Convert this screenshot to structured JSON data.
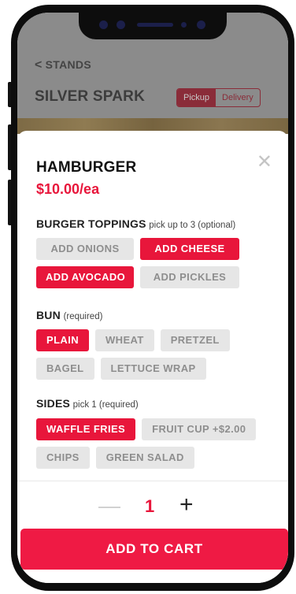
{
  "header": {
    "back_label": "STANDS",
    "store_name": "SILVER SPARK",
    "modes": [
      "Pickup",
      "Delivery"
    ]
  },
  "item": {
    "name": "HAMBURGER",
    "price": "$10.00/ea",
    "close_symbol": "✕"
  },
  "toppings": {
    "label": "BURGER TOPPINGS",
    "hint": "pick up to 3 (optional)",
    "options": [
      {
        "label": "ADD ONIONS",
        "selected": false
      },
      {
        "label": "ADD CHEESE",
        "selected": true
      },
      {
        "label": "ADD AVOCADO",
        "selected": true
      },
      {
        "label": "ADD PICKLES",
        "selected": false
      }
    ]
  },
  "bun": {
    "label": "BUN",
    "hint": "(required)",
    "options": [
      {
        "label": "PLAIN",
        "selected": true
      },
      {
        "label": "WHEAT",
        "selected": false
      },
      {
        "label": "PRETZEL",
        "selected": false
      },
      {
        "label": "BAGEL",
        "selected": false
      },
      {
        "label": "LETTUCE WRAP",
        "selected": false
      }
    ]
  },
  "sides": {
    "label": "SIDES",
    "hint": "pick 1 (required)",
    "options": [
      {
        "label": "WAFFLE FRIES",
        "selected": true
      },
      {
        "label": "FRUIT CUP +$2.00",
        "selected": false
      },
      {
        "label": "CHIPS",
        "selected": false
      },
      {
        "label": "GREEN SALAD",
        "selected": false
      }
    ]
  },
  "quantity": {
    "minus": "—",
    "value": "1",
    "plus": "+"
  },
  "cart_button": "ADD TO CART",
  "colors": {
    "accent": "#e8163b",
    "unselected_bg": "#e6e6e6",
    "unselected_text": "#8e8e8e"
  }
}
